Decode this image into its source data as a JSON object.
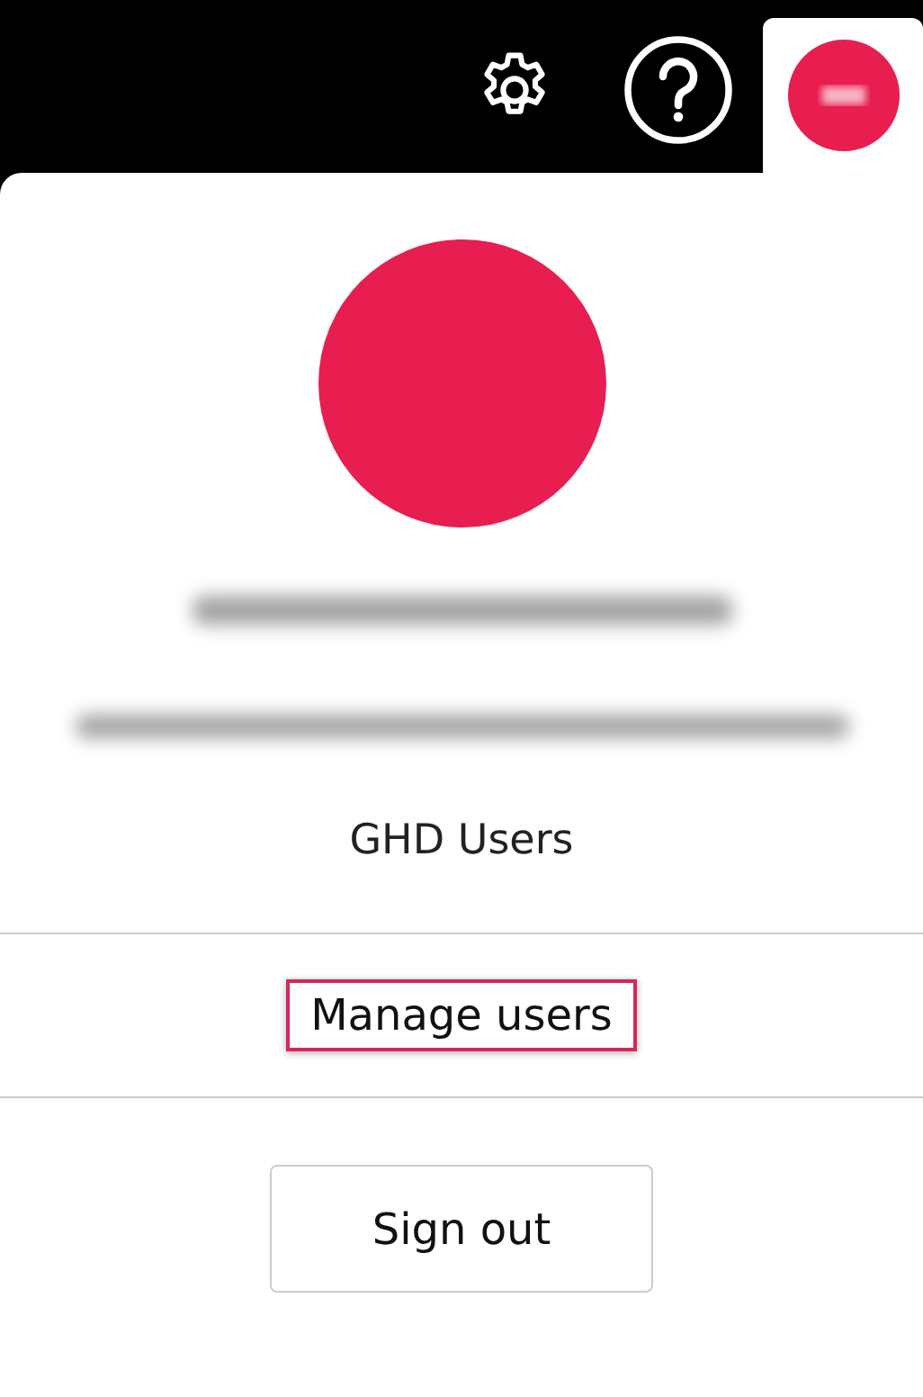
{
  "profile": {
    "group": "GHD Users"
  },
  "links": [
    {
      "label": "Manage users",
      "highlighted": true
    }
  ],
  "sign_out": {
    "label": "Sign out"
  }
}
